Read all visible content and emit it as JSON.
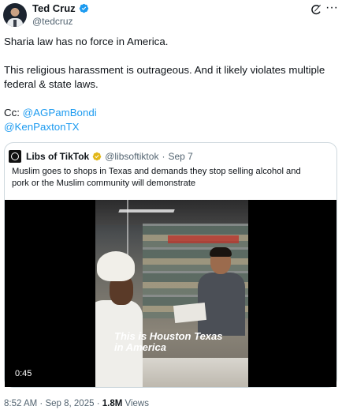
{
  "author": {
    "name": "Ted Cruz",
    "handle": "@tedcruz",
    "verified_color": "#1d9bf0"
  },
  "tweet": {
    "line1": "Sharia law has no force in America.",
    "line2": "This religious harassment is outrageous. And it likely violates multiple",
    "line3": "federal & state laws.",
    "cc_label": "Cc: ",
    "mention1": "@AGPamBondi",
    "mention2": "@KenPaxtonTX"
  },
  "quoted": {
    "name": "Libs of TikTok",
    "handle": "@libsoftiktok",
    "separator": "·",
    "date": "Sep 7",
    "text_line1": "Muslim goes to shops in Texas and demands they stop selling alcohol and",
    "text_line2": "pork or the Muslim community will demonstrate",
    "badge_color": "#e2b719",
    "video": {
      "caption_line1": "This is Houston Texas",
      "caption_line2": "in America",
      "duration": "0:45"
    }
  },
  "footer": {
    "time": "8:52 AM",
    "dot1": "·",
    "date": "Sep 8, 2025",
    "dot2": "·",
    "views_count": "1.8M",
    "views_label": "Views"
  },
  "icons": {
    "grok": "grok-icon",
    "more": "more-icon",
    "verified": "verified-badge-icon"
  },
  "colors": {
    "link": "#1d9bf0",
    "muted": "#536471",
    "text": "#0f1419"
  }
}
